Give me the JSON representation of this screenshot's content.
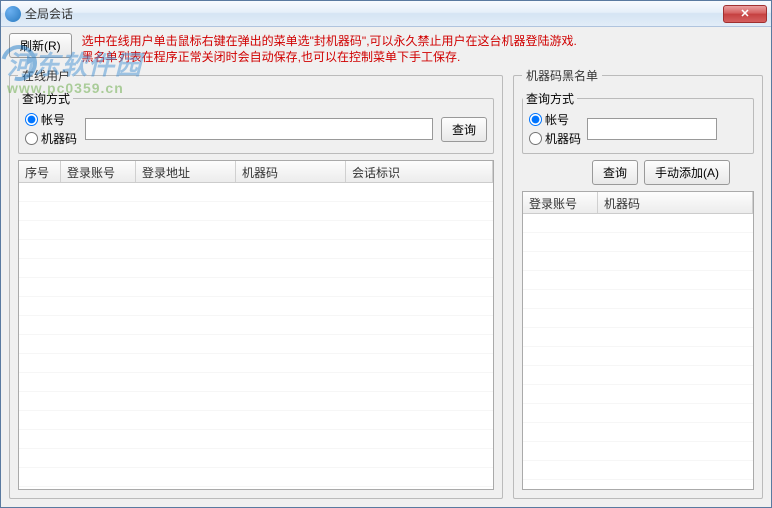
{
  "window": {
    "title": "全局会话",
    "close_glyph": "✕"
  },
  "toolbar": {
    "refresh_label": "刷新(R)"
  },
  "hint": {
    "line1": "选中在线用户单击鼠标右键在弹出的菜单选\"封机器码\",可以永久禁止用户在这台机器登陆游戏.",
    "line2": "黑名单列表在程序正常关闭时会自动保存,也可以在控制菜单下手工保存."
  },
  "left": {
    "group_title": "在线用户",
    "query": {
      "legend": "查询方式",
      "radio_account": "帐号",
      "radio_machinecode": "机器码",
      "selected": "account",
      "input_value": "",
      "search_label": "查询"
    },
    "columns": [
      "序号",
      "登录账号",
      "登录地址",
      "机器码",
      "会话标识"
    ],
    "rows": []
  },
  "right": {
    "group_title": "机器码黑名单",
    "query": {
      "legend": "查询方式",
      "radio_account": "帐号",
      "radio_machinecode": "机器码",
      "selected": "account",
      "input_value": ""
    },
    "buttons": {
      "search_label": "查询",
      "manual_add_label": "手动添加(A)"
    },
    "columns": [
      "登录账号",
      "机器码"
    ],
    "rows": []
  },
  "watermark": {
    "big": "河东软件园",
    "small": "www.pc0359.cn"
  }
}
